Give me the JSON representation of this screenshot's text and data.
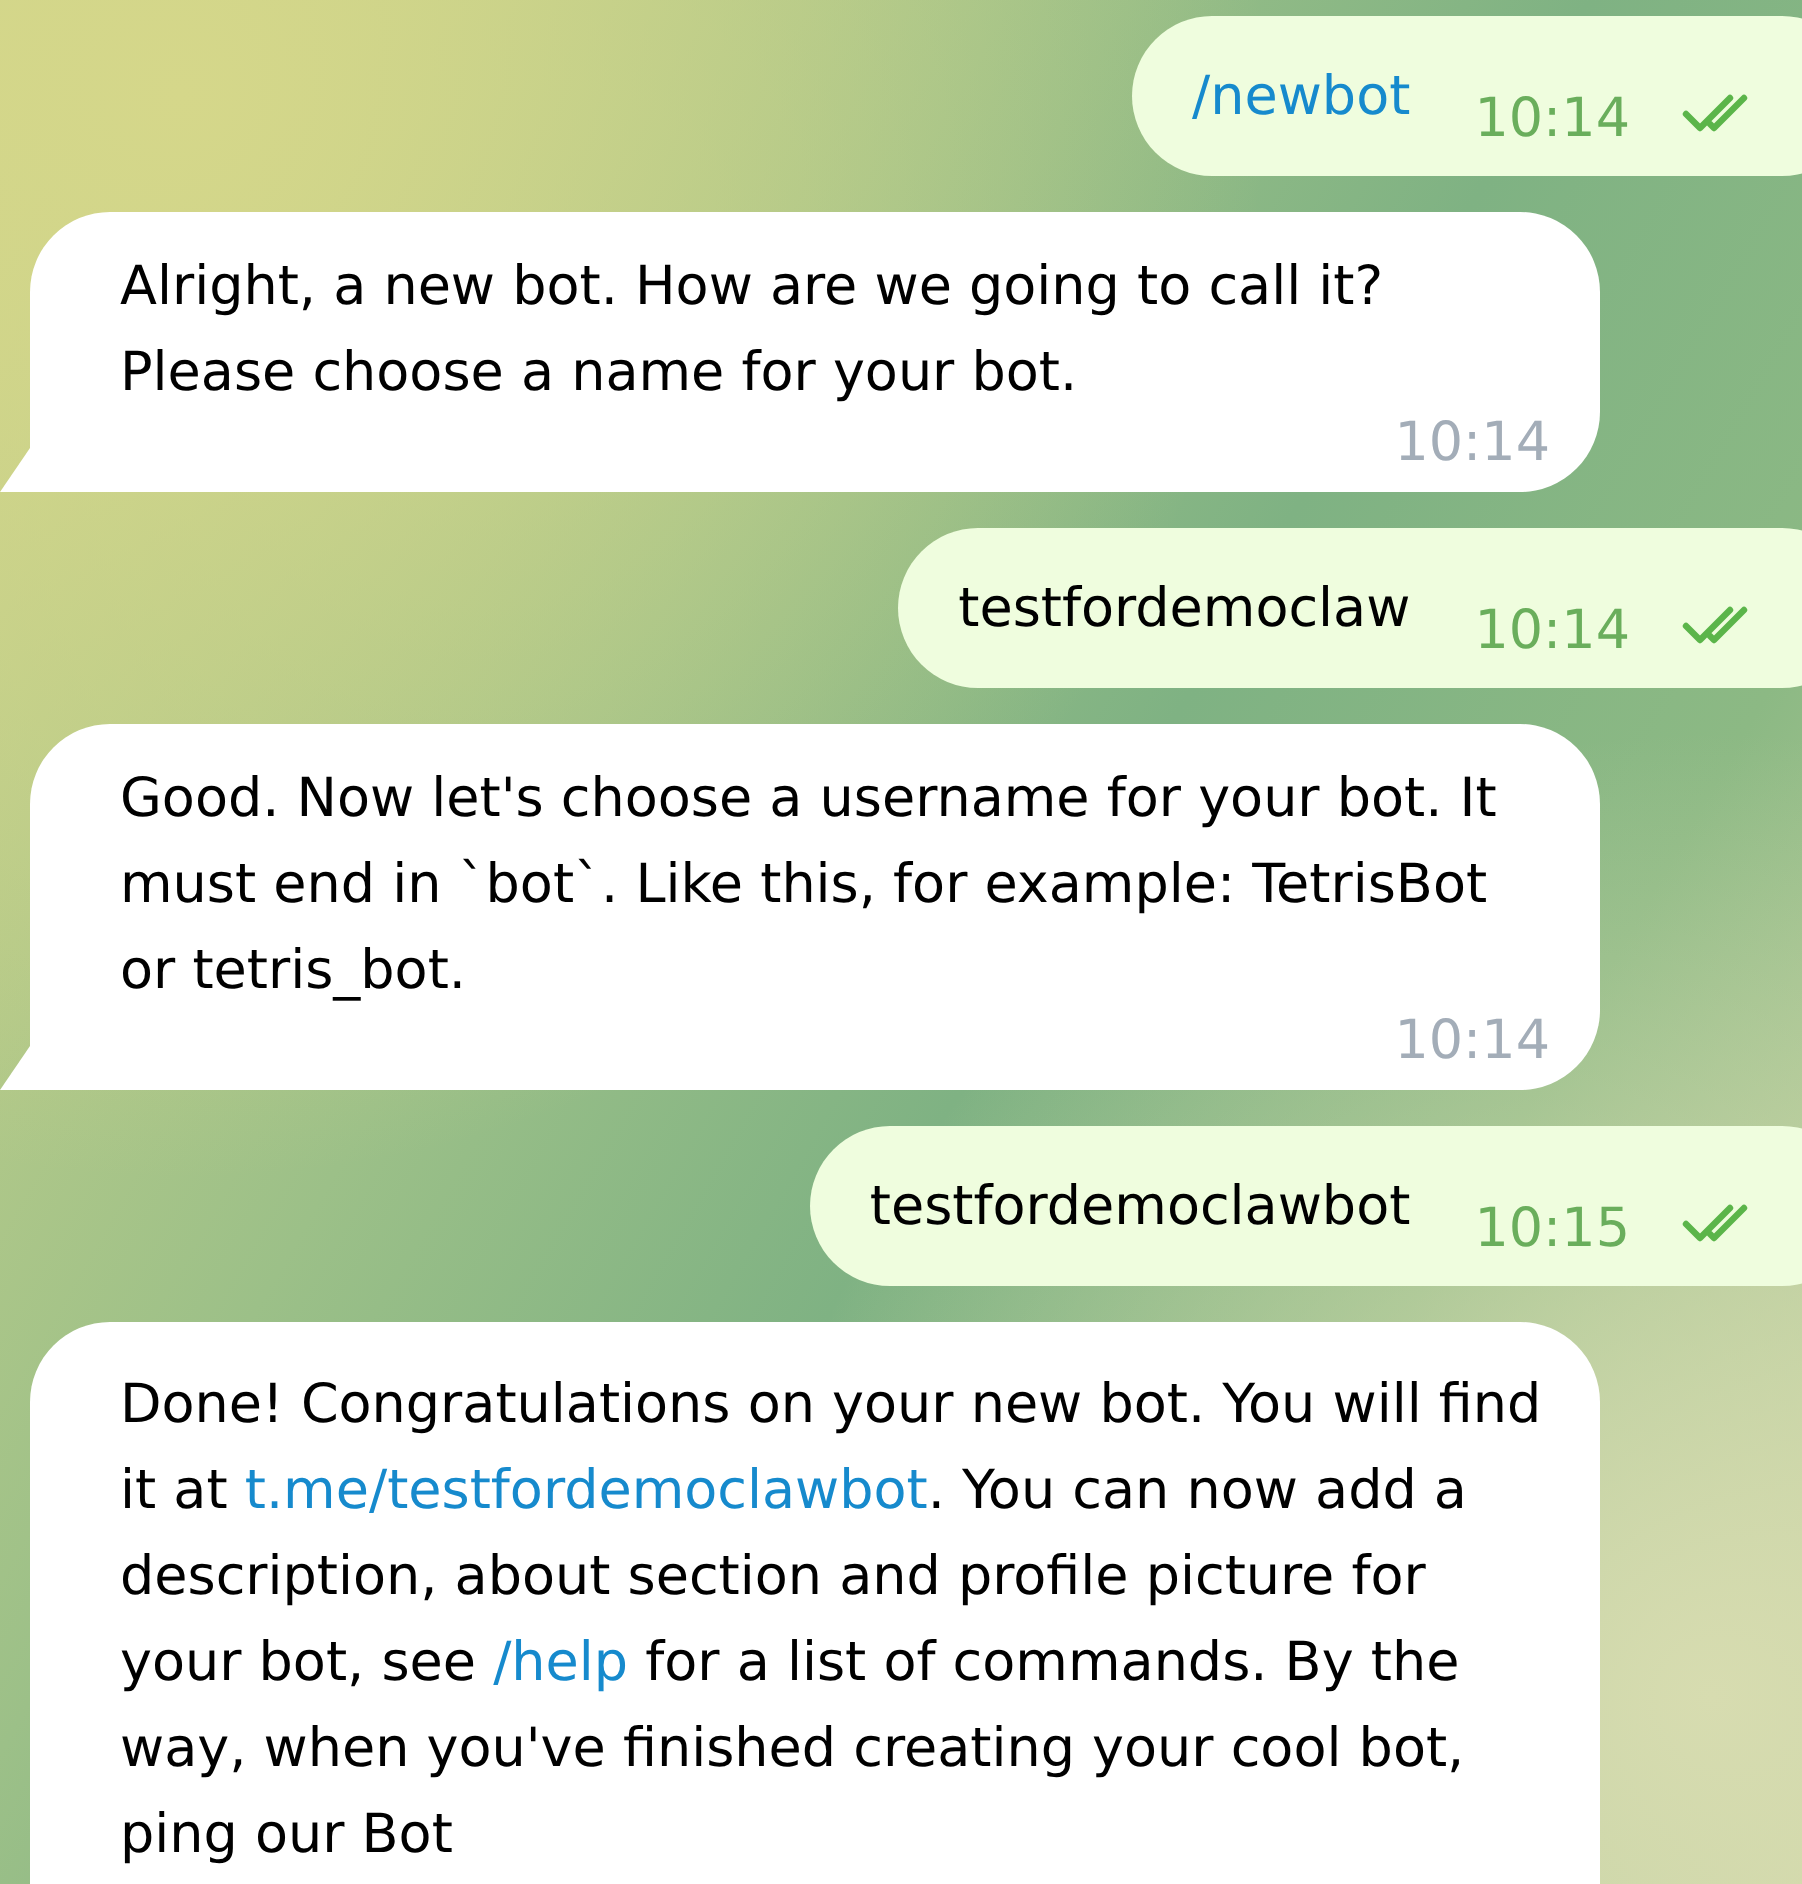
{
  "messages": [
    {
      "kind": "out",
      "parts": [
        {
          "kind": "link",
          "text": "/newbot"
        }
      ],
      "time": "10:14",
      "read": true
    },
    {
      "kind": "in",
      "parts": [
        {
          "kind": "plain",
          "text": "Alright, a new bot. How are we going to call it? Please choose a name for your bot."
        }
      ],
      "time": "10:14"
    },
    {
      "kind": "out",
      "parts": [
        {
          "kind": "plain",
          "text": "testfordemoclaw"
        }
      ],
      "time": "10:14",
      "read": true
    },
    {
      "kind": "in",
      "parts": [
        {
          "kind": "plain",
          "text": "Good. Now let's choose a username for your bot. It must end in `bot`. Like this, for example: TetrisBot or tetris_bot."
        }
      ],
      "time": "10:14"
    },
    {
      "kind": "out",
      "parts": [
        {
          "kind": "plain",
          "text": "testfordemoclawbot"
        }
      ],
      "time": "10:15",
      "read": true
    },
    {
      "kind": "in",
      "parts": [
        {
          "kind": "plain",
          "text": "Done! Congratulations on your new bot. You will find it at "
        },
        {
          "kind": "link",
          "text": "t.me/testfordemoclawbot"
        },
        {
          "kind": "plain",
          "text": ". You can now add a description, about section and profile picture for your bot, see "
        },
        {
          "kind": "link",
          "text": "/help"
        },
        {
          "kind": "plain",
          "text": " for a list of commands. By the way, when you've finished creating your cool bot, ping our Bot"
        }
      ]
    }
  ]
}
